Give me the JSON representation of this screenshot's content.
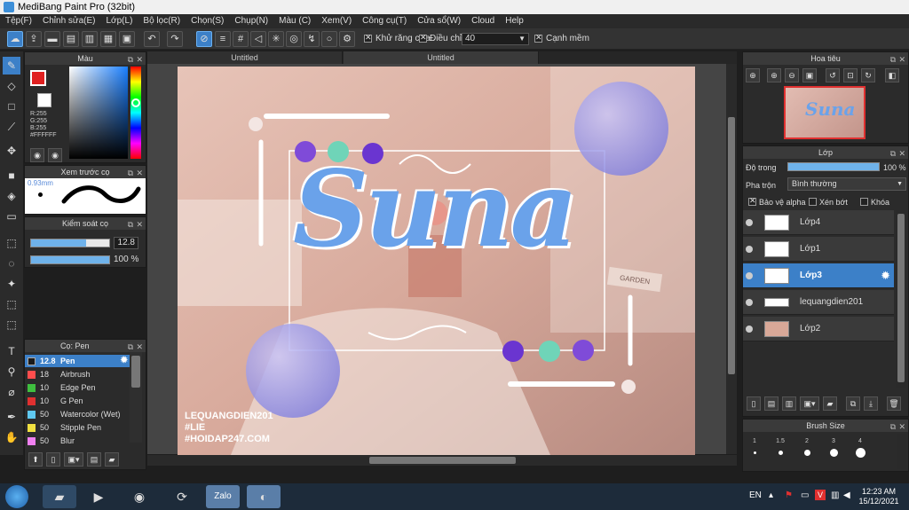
{
  "window": {
    "title": "MediBang Paint Pro (32bit)"
  },
  "menu": [
    "Tệp(F)",
    "Chỉnh sửa(E)",
    "Lớp(L)",
    "Bộ lọc(R)",
    "Chọn(S)",
    "Chụp(N)",
    "Màu (C)",
    "Xem(V)",
    "Công cụ(T)",
    "Cửa sổ(W)",
    "Cloud",
    "Help"
  ],
  "toolbar": {
    "antialias_label": "Khử răng cưa",
    "adjust_label": "Điều chỉnh",
    "adjust_value": "40",
    "snap_label": "Cạnh mềm"
  },
  "color_panel": {
    "title": "Màu",
    "r": "R:255",
    "g": "G:255",
    "b": "B:255",
    "hex": "#FFFFFF",
    "primary": "#e02020",
    "secondary": "#ffffff"
  },
  "preview_panel": {
    "title": "Xem trước cọ",
    "size": "0.93mm"
  },
  "brush_control": {
    "title": "Kiểm soát cọ",
    "size": "12.8",
    "size_fraction": 0.7,
    "opacity": "100 %",
    "opacity_fraction": 1.0
  },
  "brush_panel": {
    "title": "Cọ: Pen",
    "items": [
      {
        "size": "12.8",
        "name": "Pen",
        "color": "#1a1a1a"
      },
      {
        "size": "18",
        "name": "Airbrush",
        "color": "#ff4d4d"
      },
      {
        "size": "10",
        "name": "Edge Pen",
        "color": "#3fbf3f"
      },
      {
        "size": "10",
        "name": "G Pen",
        "color": "#e03030"
      },
      {
        "size": "50",
        "name": "Watercolor (Wet)",
        "color": "#5fc8f0"
      },
      {
        "size": "50",
        "name": "Stipple Pen",
        "color": "#f0e040"
      },
      {
        "size": "50",
        "name": "Blur",
        "color": "#f080f0"
      }
    ]
  },
  "tabs": [
    "Untitled",
    "Untitled"
  ],
  "art": {
    "title_text": "Suna",
    "watermark_1": "LEQUANGDIEN201",
    "watermark_2": "#LIE",
    "watermark_3": "#HOIDAP247.COM",
    "sign_text": "GARDEN"
  },
  "navigator_panel": {
    "title": "Hoa tiêu"
  },
  "layer_panel": {
    "title": "Lớp",
    "opacity_label": "Độ trong",
    "opacity_value": "100 %",
    "opacity_fraction": 1.0,
    "blend_label": "Pha trộn",
    "blend_value": "Bình thường",
    "protect_alpha": "Bảo vệ alpha",
    "clipping": "Xén bớt",
    "lock": "Khóa",
    "layers": [
      {
        "name": "Lớp4"
      },
      {
        "name": "Lớp1"
      },
      {
        "name": "Lớp3"
      },
      {
        "name": "lequangdien201"
      },
      {
        "name": "Lớp2"
      }
    ]
  },
  "brush_size_panel": {
    "title": "Brush Size",
    "sizes": [
      "1",
      "1.5",
      "2",
      "3",
      "4"
    ]
  },
  "taskbar": {
    "lang": "EN",
    "time": "12:23 AM",
    "date": "15/12/2021",
    "zalo": "Zalo"
  }
}
